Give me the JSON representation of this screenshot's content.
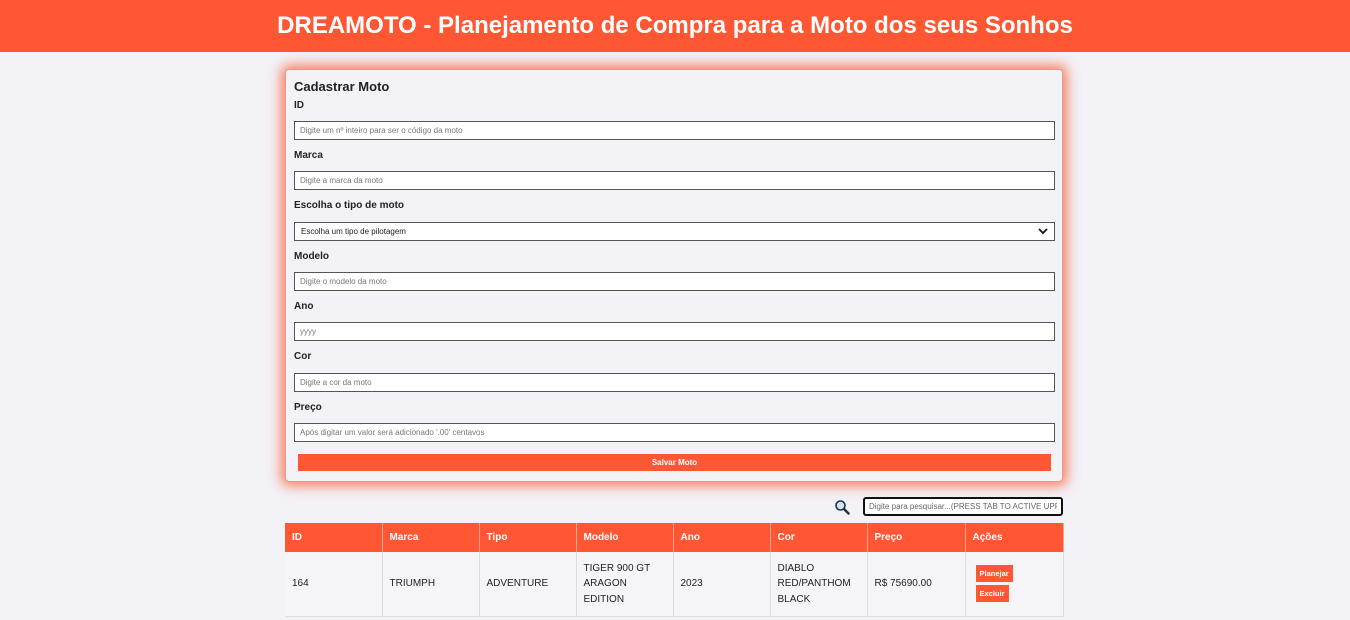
{
  "header": {
    "title": "DREAMOTO - Planejamento de Compra para a Moto dos seus Sonhos"
  },
  "form": {
    "title": "Cadastrar Moto",
    "fields": [
      {
        "label": "ID",
        "placeholder": "Digite um nº inteiro para ser o código da moto"
      },
      {
        "label": "Marca",
        "placeholder": "Digite a marca da moto"
      },
      {
        "label": "Escolha o tipo de moto",
        "selected": "Escolha um tipo de pilotagem"
      },
      {
        "label": "Modelo",
        "placeholder": "Digite o modelo da moto"
      },
      {
        "label": "Ano",
        "placeholder": "yyyy"
      },
      {
        "label": "Cor",
        "placeholder": "Digite a cor da moto"
      },
      {
        "label": "Preço",
        "placeholder": "Após digitar um valor será adicionado '.00' centavos"
      }
    ],
    "save_label": "Salvar Moto"
  },
  "search": {
    "placeholder": "Digite para pesquisar...(PRESS TAB TO ACTIVE UPP"
  },
  "table": {
    "headers": [
      "ID",
      "Marca",
      "Tipo",
      "Modelo",
      "Ano",
      "Cor",
      "Preço",
      "Ações"
    ],
    "rows": [
      {
        "id": "164",
        "marca": "TRIUMPH",
        "tipo": "ADVENTURE",
        "modelo": "TIGER 900 GT ARAGON EDITION",
        "ano": "2023",
        "cor": "DIABLO RED/PANTHOM BLACK",
        "preco": "R$ 75690.00",
        "planejar": "Planejar",
        "excluir": "Excluir"
      }
    ]
  },
  "colors": {
    "accent": "#ff5733",
    "background": "#f2f2f7"
  },
  "icons": {
    "search": "magnifier-icon",
    "select": "chevron-down-icon"
  }
}
